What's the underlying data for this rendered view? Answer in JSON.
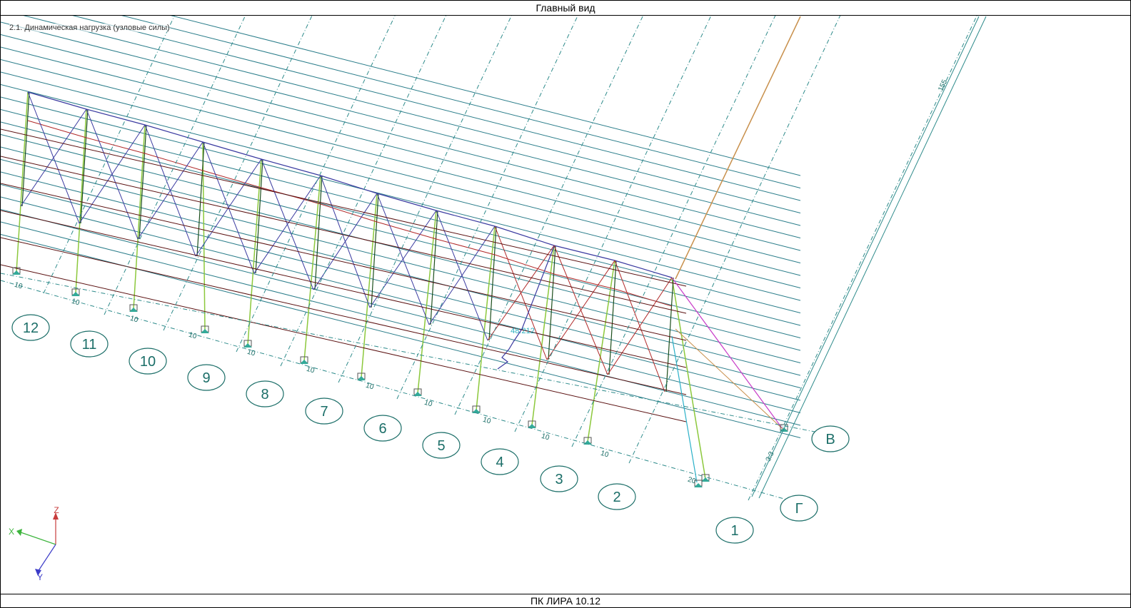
{
  "window": {
    "title": "Главный вид",
    "footer": "ПК ЛИРА 10.12"
  },
  "load_case": {
    "label": "2.1. Динамическая нагрузка (узловые силы)"
  },
  "axes_letters": [
    "В",
    "Г"
  ],
  "axes_numbers": [
    "1",
    "2",
    "3",
    "4",
    "5",
    "6",
    "7",
    "8",
    "9",
    "10",
    "11",
    "12"
  ],
  "dimensions": {
    "bay_spacing": "10",
    "end_bay": "20",
    "side_small": "3.3",
    "side_large": "155"
  },
  "result_value": "48.212",
  "coordinate_axes": {
    "x": "X",
    "y": "Y",
    "z": "Z"
  },
  "colors": {
    "grid_teal": "#2e8b8b",
    "label_teal": "#1b6e68",
    "purlin": "#2a7d8a",
    "truss_blue": "#3a3aa0",
    "truss_red": "#b02828",
    "column_green": "#8cc83c",
    "rafter_orange": "#c8904c",
    "beam_darkred": "#5a1010",
    "magenta": "#c83cc8",
    "cyan": "#2ab0c8"
  }
}
